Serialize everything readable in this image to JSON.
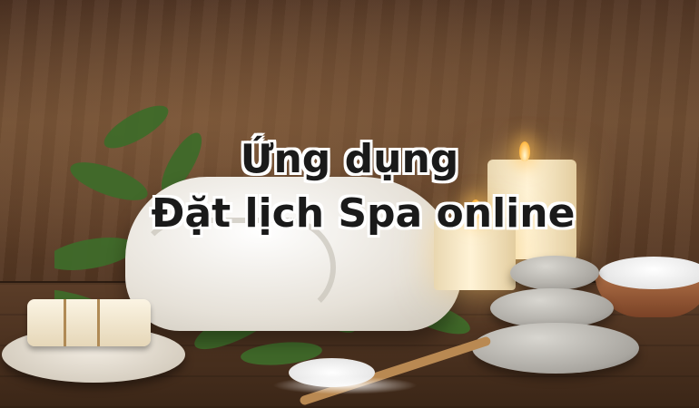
{
  "banner": {
    "title_line1": "Ứng dụng",
    "title_line2": "Đặt lịch Spa online"
  },
  "colors": {
    "text": "#1a1a1a",
    "text_outline": "#ffffff",
    "wood": "#5b3d28",
    "candle_glow": "#ffb640"
  },
  "scene_objects": [
    "wood-wall-background",
    "towel",
    "candles",
    "stacked-stones",
    "soap",
    "salt-bowl",
    "wooden-spoon",
    "leaves"
  ]
}
